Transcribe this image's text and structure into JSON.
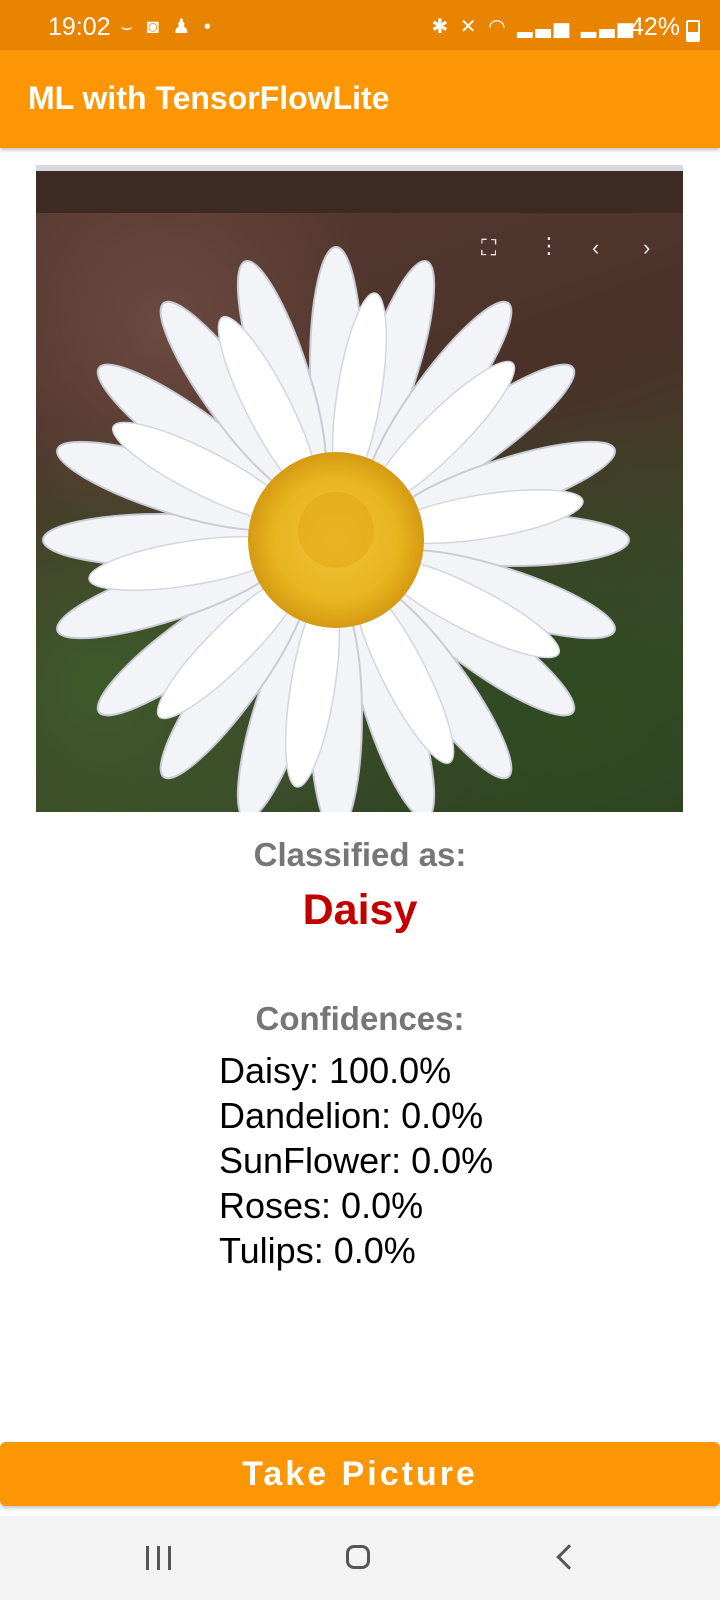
{
  "status_bar": {
    "time": "19:02",
    "battery": "42%",
    "left_icons": [
      "pill-icon",
      "game-controller-icon",
      "kid-icon",
      "dot-icon"
    ],
    "right_icons": [
      "bluetooth-icon",
      "mute-icon",
      "wifi-icon",
      "signal-icon",
      "signal-icon",
      "battery-icon"
    ]
  },
  "app_bar": {
    "title": "ML with TensorFlowLite"
  },
  "photo": {
    "subject": "daisy flower",
    "overlay_icons": [
      "screenshot-icon",
      "more-vertical-icon",
      "chevron-left-icon",
      "chevron-right-icon"
    ]
  },
  "result": {
    "label": "Classified as:",
    "value": "Daisy"
  },
  "confidences": {
    "label": "Confidences:",
    "items": [
      "Daisy: 100.0%",
      "Dandelion: 0.0%",
      "SunFlower: 0.0%",
      "Roses: 0.0%",
      "Tulips: 0.0%"
    ]
  },
  "button": {
    "take_picture": "Take Picture"
  },
  "nav_bar": {
    "items": [
      "recents-icon",
      "home-icon",
      "back-icon"
    ]
  },
  "colors": {
    "status_bar": "#e98400",
    "primary": "#fc9604",
    "result": "#c20000",
    "label": "#767676"
  }
}
